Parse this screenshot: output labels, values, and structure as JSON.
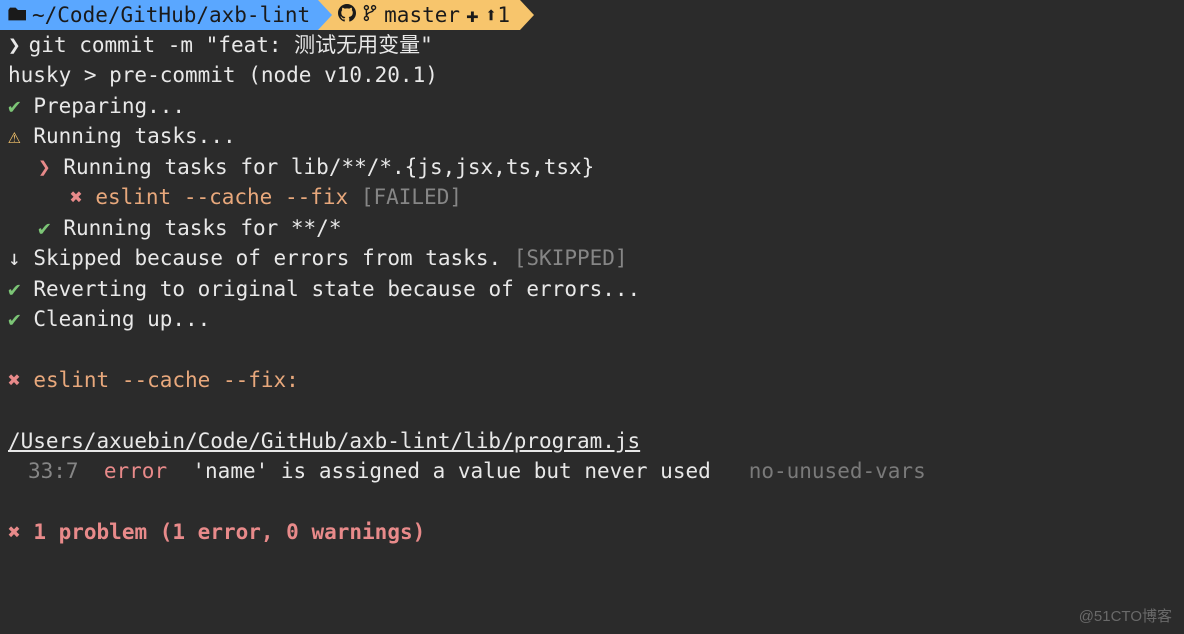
{
  "prompt": {
    "path": "~/Code/GitHub/axb-lint",
    "branch": "master",
    "ahead": "1",
    "plus_icon": "✚",
    "up_icon": "⬆",
    "end_arrow": "➔"
  },
  "command": {
    "marker": "❯",
    "text": "git commit -m \"feat: 测试无用变量\""
  },
  "husky_line": "husky > pre-commit (node v10.20.1)",
  "steps": {
    "preparing": "Preparing...",
    "running_tasks": "Running tasks...",
    "running_tasks_glob": "Running tasks for lib/**/*.{js,jsx,ts,tsx}",
    "eslint_cmd": "eslint --cache --fix",
    "eslint_failed": "[FAILED]",
    "running_tasks_all": "Running tasks for **/*",
    "skipped": "Skipped because of errors from tasks.",
    "skipped_tag": "[SKIPPED]",
    "reverting": "Reverting to original state because of errors...",
    "cleaning": "Cleaning up..."
  },
  "error_header": "eslint --cache --fix:",
  "error_file": "/Users/axuebin/Code/GitHub/axb-lint/lib/program.js",
  "error_detail": {
    "location": "33:7",
    "severity": "error",
    "message": "'name' is assigned a value but never used",
    "rule": "no-unused-vars"
  },
  "summary": "1 problem (1 error, 0 warnings)",
  "icons": {
    "check": "✔",
    "warn": "⚠",
    "x": "✖",
    "chevron": "❯",
    "down": "↓"
  },
  "watermark": "@51CTO博客"
}
